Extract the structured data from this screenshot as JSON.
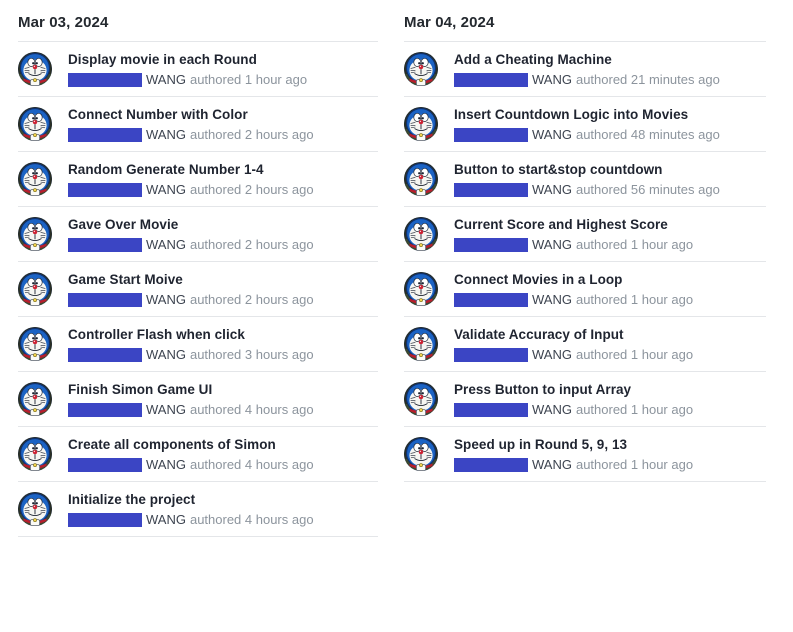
{
  "colors": {
    "redaction_bar": "#3b45c4",
    "title_text": "#1f2430",
    "author_text": "#3d4450",
    "meta_text": "#8c949d",
    "divider": "#e4e6e9",
    "background": "#ffffff"
  },
  "columns": [
    {
      "date_heading": "Mar 03, 2024",
      "commits": [
        {
          "title": "Display movie in each Round",
          "author": "WANG",
          "meta": "authored 1 hour ago",
          "avatar_icon": "doraemon-avatar"
        },
        {
          "title": "Connect Number with Color",
          "author": "WANG",
          "meta": "authored 2 hours ago",
          "avatar_icon": "doraemon-avatar"
        },
        {
          "title": "Random Generate Number 1-4",
          "author": "WANG",
          "meta": "authored 2 hours ago",
          "avatar_icon": "doraemon-avatar"
        },
        {
          "title": "Gave Over Movie",
          "author": "WANG",
          "meta": "authored 2 hours ago",
          "avatar_icon": "doraemon-avatar"
        },
        {
          "title": "Game Start Moive",
          "author": "WANG",
          "meta": "authored 2 hours ago",
          "avatar_icon": "doraemon-avatar"
        },
        {
          "title": "Controller Flash when click",
          "author": "WANG",
          "meta": "authored 3 hours ago",
          "avatar_icon": "doraemon-avatar"
        },
        {
          "title": "Finish Simon Game UI",
          "author": "WANG",
          "meta": "authored 4 hours ago",
          "avatar_icon": "doraemon-avatar"
        },
        {
          "title": "Create all components of Simon",
          "author": "WANG",
          "meta": "authored 4 hours ago",
          "avatar_icon": "doraemon-avatar"
        },
        {
          "title": "Initialize the project",
          "author": "WANG",
          "meta": "authored 4 hours ago",
          "avatar_icon": "doraemon-avatar"
        }
      ]
    },
    {
      "date_heading": "Mar 04, 2024",
      "commits": [
        {
          "title": "Add a Cheating Machine",
          "author": "WANG",
          "meta": "authored 21 minutes ago",
          "avatar_icon": "doraemon-avatar"
        },
        {
          "title": "Insert Countdown Logic into Movies",
          "author": "WANG",
          "meta": "authored 48 minutes ago",
          "avatar_icon": "doraemon-avatar"
        },
        {
          "title": "Button to start&stop countdown",
          "author": "WANG",
          "meta": "authored 56 minutes ago",
          "avatar_icon": "doraemon-avatar"
        },
        {
          "title": "Current Score and Highest Score",
          "author": "WANG",
          "meta": "authored 1 hour ago",
          "avatar_icon": "doraemon-avatar"
        },
        {
          "title": "Connect Movies in a Loop",
          "author": "WANG",
          "meta": "authored 1 hour ago",
          "avatar_icon": "doraemon-avatar"
        },
        {
          "title": "Validate Accuracy of Input",
          "author": "WANG",
          "meta": "authored 1 hour ago",
          "avatar_icon": "doraemon-avatar"
        },
        {
          "title": "Press Button to input Array",
          "author": "WANG",
          "meta": "authored 1 hour ago",
          "avatar_icon": "doraemon-avatar"
        },
        {
          "title": "Speed up in Round 5, 9, 13",
          "author": "WANG",
          "meta": "authored 1 hour ago",
          "avatar_icon": "doraemon-avatar"
        }
      ]
    }
  ]
}
